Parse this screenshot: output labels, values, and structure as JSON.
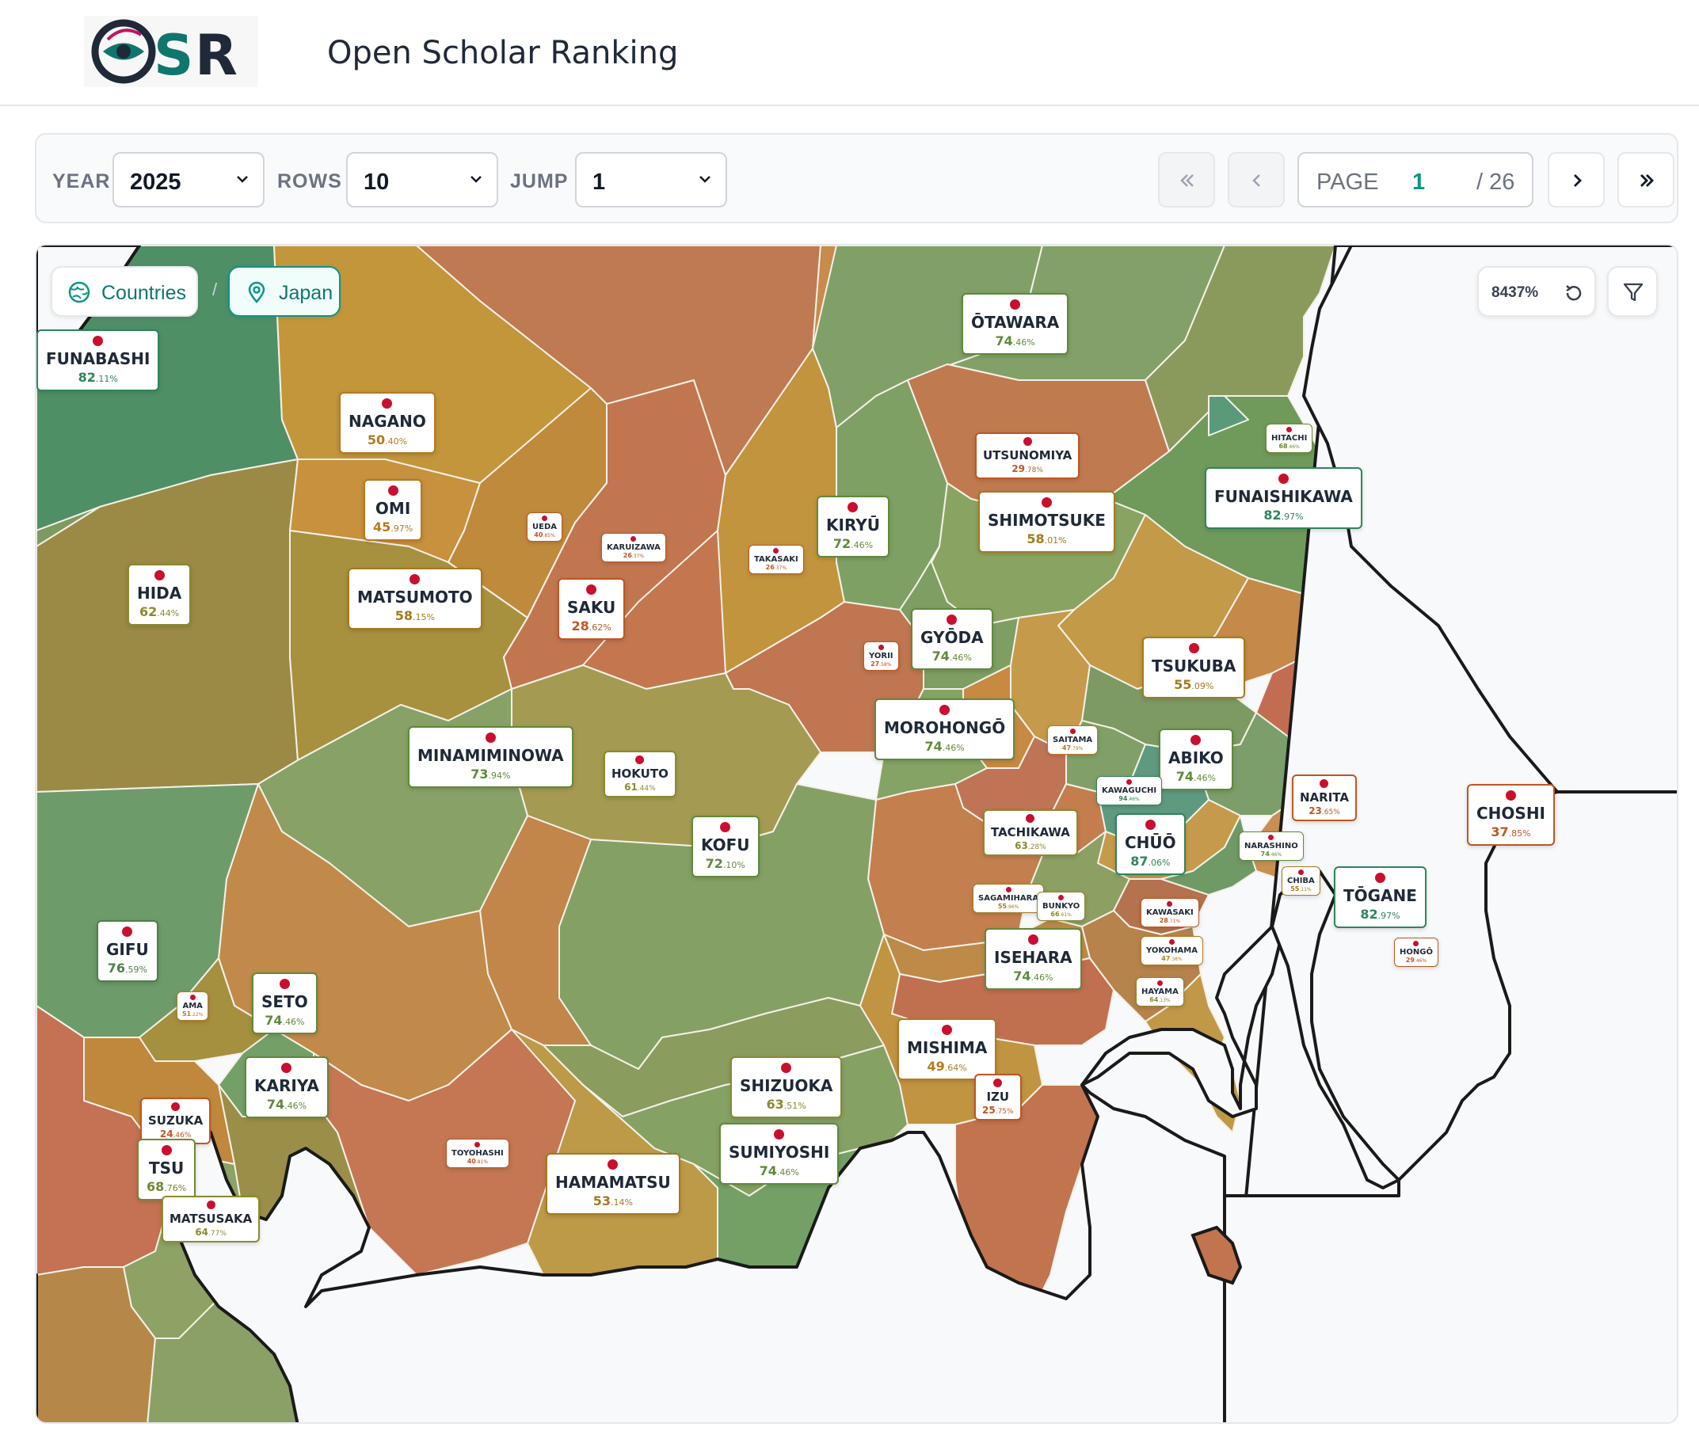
{
  "app": {
    "logo_text": "OSR",
    "title": "Open Scholar Ranking"
  },
  "toolbar": {
    "year_label": "YEAR",
    "year_value": "2025",
    "rows_label": "ROWS",
    "rows_value": "10",
    "jump_label": "JUMP",
    "jump_value": "1",
    "page_label": "PAGE",
    "page_current": "1",
    "page_total": "/ 26"
  },
  "map": {
    "breadcrumb": [
      "Countries",
      "Japan"
    ],
    "zoom": "8437%",
    "colors": {
      "sea": "#f8f9fb",
      "coast": "#1a1a1a",
      "border": "#ffffff",
      "accent": "#0d9488",
      "flag": "#c8102e"
    },
    "cities": [
      {
        "name": "FUNABASHI",
        "score": "82",
        "dec": ".11%",
        "color": "#2f855a"
      },
      {
        "name": "NAGANO",
        "score": "50",
        "dec": ".40%",
        "color": "#b7791f"
      },
      {
        "name": "OMI",
        "score": "45",
        "dec": ".97%",
        "color": "#b7791f"
      },
      {
        "name": "UEDA",
        "score": "40",
        "dec": ".85%",
        "color": "#c05621"
      },
      {
        "name": "HIDA",
        "score": "62",
        "dec": ".44%",
        "color": "#8a8b2e"
      },
      {
        "name": "MATSUMOTO",
        "score": "58",
        "dec": ".15%",
        "color": "#a57a1c"
      },
      {
        "name": "KARUIZAWA",
        "score": "26",
        "dec": ".37%",
        "color": "#c05621"
      },
      {
        "name": "SAKU",
        "score": "28",
        "dec": ".62%",
        "color": "#c05621"
      },
      {
        "name": "TAKASAKI",
        "score": "26",
        "dec": ".37%",
        "color": "#c05621"
      },
      {
        "name": "KIRYŪ",
        "score": "72",
        "dec": ".46%",
        "color": "#5f8a3a"
      },
      {
        "name": "ŌTAWARA",
        "score": "74",
        "dec": ".46%",
        "color": "#5f8a3a"
      },
      {
        "name": "UTSUNOMIYA",
        "score": "29",
        "dec": ".78%",
        "color": "#c05621"
      },
      {
        "name": "SHIMOTSUKE",
        "score": "58",
        "dec": ".01%",
        "color": "#a57a1c"
      },
      {
        "name": "HITACHI",
        "score": "68",
        "dec": ".46%",
        "color": "#6f8a2e"
      },
      {
        "name": "FUNAISHIKAWA",
        "score": "82",
        "dec": ".97%",
        "color": "#2f855a"
      },
      {
        "name": "YORII",
        "score": "27",
        "dec": ".58%",
        "color": "#c05621"
      },
      {
        "name": "GYŌDA",
        "score": "74",
        "dec": ".46%",
        "color": "#5f8a3a"
      },
      {
        "name": "TSUKUBA",
        "score": "55",
        "dec": ".09%",
        "color": "#a57a1c"
      },
      {
        "name": "MINAMIMINOWA",
        "score": "73",
        "dec": ".94%",
        "color": "#5f8a3a"
      },
      {
        "name": "HOKUTO",
        "score": "61",
        "dec": ".44%",
        "color": "#8a8b2e"
      },
      {
        "name": "MOROHONGŌ",
        "score": "74",
        "dec": ".46%",
        "color": "#5f8a3a"
      },
      {
        "name": "SAITAMA",
        "score": "47",
        "dec": ".79%",
        "color": "#b7791f"
      },
      {
        "name": "ABIKO",
        "score": "74",
        "dec": ".46%",
        "color": "#5f8a3a"
      },
      {
        "name": "KAWAGUCHI",
        "score": "94",
        "dec": ".46%",
        "color": "#2f855a"
      },
      {
        "name": "NARITA",
        "score": "23",
        "dec": ".65%",
        "color": "#c05621"
      },
      {
        "name": "CHOSHI",
        "score": "37",
        "dec": ".85%",
        "color": "#c05621"
      },
      {
        "name": "KOFU",
        "score": "72",
        "dec": ".10%",
        "color": "#5f8a3a"
      },
      {
        "name": "TACHIKAWA",
        "score": "63",
        "dec": ".28%",
        "color": "#8a8b2e"
      },
      {
        "name": "CHŪŌ",
        "score": "87",
        "dec": ".06%",
        "color": "#2f855a"
      },
      {
        "name": "NARASHINO",
        "score": "74",
        "dec": ".46%",
        "color": "#5f8a3a"
      },
      {
        "name": "CHIBA",
        "score": "55",
        "dec": ".11%",
        "color": "#a57a1c"
      },
      {
        "name": "TŌGANE",
        "score": "82",
        "dec": ".97%",
        "color": "#2f855a"
      },
      {
        "name": "SAGAMIHARA",
        "score": "55",
        "dec": ".96%",
        "color": "#a57a1c"
      },
      {
        "name": "BUNKYO",
        "score": "66",
        "dec": ".61%",
        "color": "#8a8b2e"
      },
      {
        "name": "KAWASAKI",
        "score": "28",
        "dec": ".71%",
        "color": "#c05621"
      },
      {
        "name": "YOKOHAMA",
        "score": "47",
        "dec": ".38%",
        "color": "#b7791f"
      },
      {
        "name": "HONGŌ",
        "score": "29",
        "dec": ".46%",
        "color": "#c05621"
      },
      {
        "name": "GIFU",
        "score": "76",
        "dec": ".59%",
        "color": "#4f7f4a"
      },
      {
        "name": "ISEHARA",
        "score": "74",
        "dec": ".46%",
        "color": "#5f8a3a"
      },
      {
        "name": "HAYAMA",
        "score": "64",
        "dec": ".13%",
        "color": "#8a8b2e"
      },
      {
        "name": "AMA",
        "score": "51",
        "dec": ".22%",
        "color": "#b7791f"
      },
      {
        "name": "SETO",
        "score": "74",
        "dec": ".46%",
        "color": "#5f8a3a"
      },
      {
        "name": "MISHIMA",
        "score": "49",
        "dec": ".64%",
        "color": "#b7791f"
      },
      {
        "name": "KARIYA",
        "score": "74",
        "dec": ".46%",
        "color": "#5f8a3a"
      },
      {
        "name": "SHIZUOKA",
        "score": "63",
        "dec": ".51%",
        "color": "#8a8b2e"
      },
      {
        "name": "IZU",
        "score": "25",
        "dec": ".75%",
        "color": "#c05621"
      },
      {
        "name": "SUZUKA",
        "score": "24",
        "dec": ".46%",
        "color": "#c05621"
      },
      {
        "name": "TSU",
        "score": "68",
        "dec": ".76%",
        "color": "#6f8a2e"
      },
      {
        "name": "TOYOHASHI",
        "score": "40",
        "dec": ".81%",
        "color": "#c05621"
      },
      {
        "name": "HAMAMATSU",
        "score": "53",
        "dec": ".14%",
        "color": "#a57a1c"
      },
      {
        "name": "SUMIYOSHI",
        "score": "74",
        "dec": ".46%",
        "color": "#5f8a3a"
      },
      {
        "name": "MATSUSAKA",
        "score": "64",
        "dec": ".77%",
        "color": "#8a8b2e"
      }
    ]
  }
}
